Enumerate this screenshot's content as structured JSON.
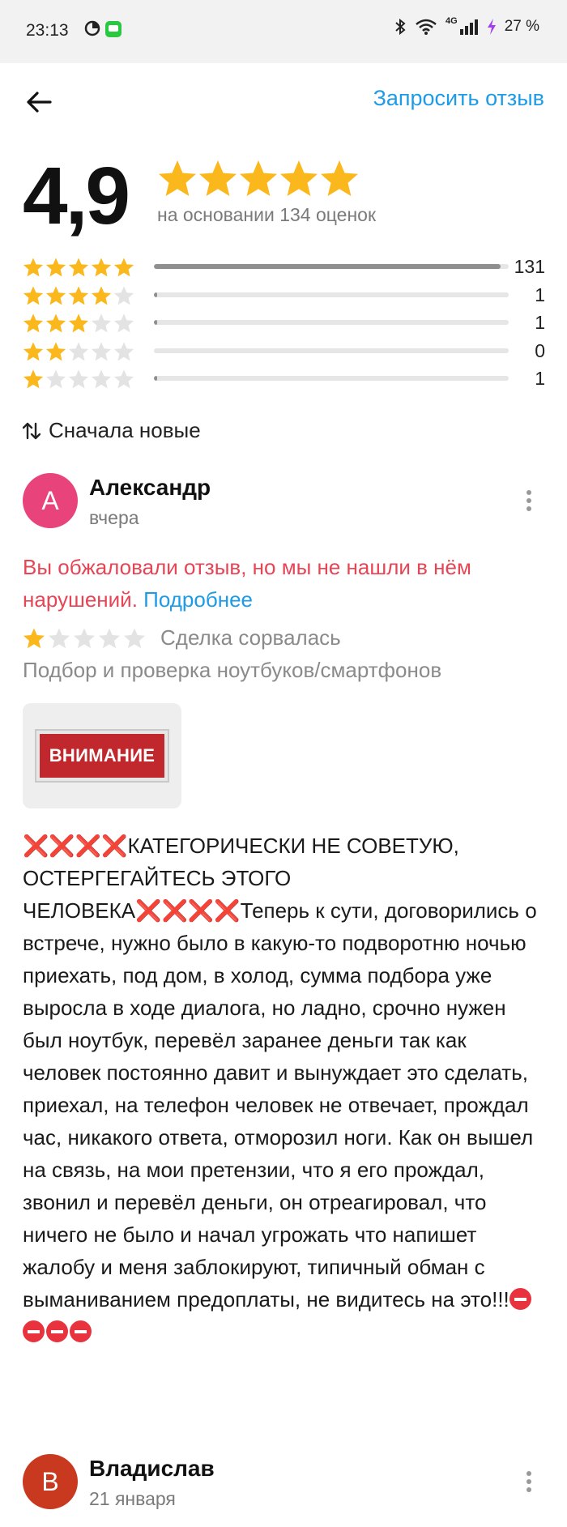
{
  "status_bar": {
    "time": "23:13",
    "battery": "27 %",
    "network": "4G"
  },
  "header": {
    "request_review_label": "Запросить отзыв"
  },
  "summary": {
    "rating": "4,9",
    "stars_filled": 5,
    "based_on": "на основании 134 оценок",
    "distribution": [
      {
        "stars": 5,
        "count": "131",
        "fraction": 0.977
      },
      {
        "stars": 4,
        "count": "1",
        "fraction": 0.0075
      },
      {
        "stars": 3,
        "count": "1",
        "fraction": 0.0075
      },
      {
        "stars": 2,
        "count": "0",
        "fraction": 0.0
      },
      {
        "stars": 1,
        "count": "1",
        "fraction": 0.0075
      }
    ]
  },
  "sort": {
    "label": "Сначала новые"
  },
  "reviews": [
    {
      "initial": "А",
      "avatar_color": "#e8437a",
      "name": "Александр",
      "date": "вчера",
      "appeal_text": "Вы обжаловали отзыв, но мы не нашли в нём нарушений.",
      "appeal_link": "Подробнее",
      "rating": 1,
      "deal_status": "Сделка сорвалась",
      "service": "Подбор и проверка ноутбуков/смартфонов",
      "photo_text": "ВНИМАНИЕ",
      "text_head": "КАТЕГОРИЧЕСКИ НЕ СОВЕТУЮ, ОСТЕРГЕГАЙТЕСЬ ЭТОГО ЧЕЛОВЕКА",
      "text_body": "Теперь к сути, договорились о встрече, нужно было в какую-то подворотню ночью приехать, под дом, в холод, сумма подбора уже выросла в ходе диалога, но ладно, срочно нужен был ноутбук, перевёл заранее деньги так как человек постоянно давит и вынуждает это сделать, приехал, на телефон человек не отвечает, прождал час, никакого ответа, отморозил ноги. Как он вышел на связь, на мои претензии, что я его прождал, звонил и перевёл деньги, он отреагировал, что ничего не было и начал угрожать что напишет жалобу и меня заблокируют, типичный обман с выманиванием предоплаты, не видитесь на это!!!",
      "x_marks": "❌❌❌❌",
      "stop_count": 4
    },
    {
      "initial": "В",
      "avatar_color": "#c9391f",
      "name": "Владислав",
      "date": "21 января"
    }
  ],
  "colors": {
    "accent": "#1e9be6",
    "star": "#fbb81c",
    "warning": "#e64556"
  }
}
